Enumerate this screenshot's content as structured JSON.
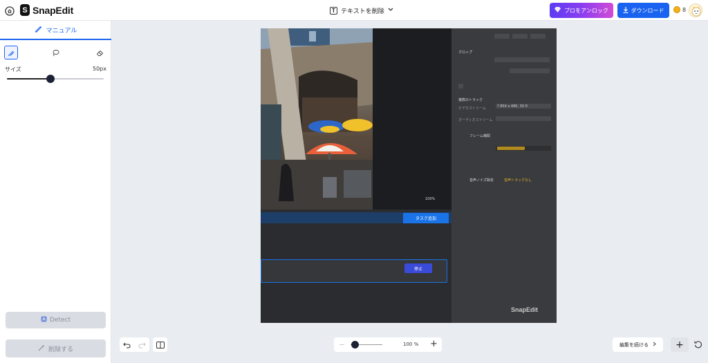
{
  "header": {
    "logo_mark": "S",
    "logo_text": "SnapEdit",
    "tool_badge": "T",
    "tool_label": "テキストを削除",
    "pro_button": "プロをアンロック",
    "download_button": "ダウンロード",
    "credits": "8"
  },
  "sidebar": {
    "tab_label": "マニュアル",
    "size_label": "サイズ",
    "size_value": "50px",
    "size_fraction": 0.45,
    "detect_button": "Detect",
    "remove_button": "削除する"
  },
  "canvas": {
    "task_button": "タスク追加",
    "stop_button": "停止",
    "watermark": "SnapEdit",
    "zoom_readout": "100%",
    "panel": {
      "crop_title": "クロップ",
      "tracks_title": "複数のトラック",
      "video_stream_label": "ビデオストリーム",
      "video_stream_value": "? 854 x 480, 30 fl",
      "audio_stream_label": "オーディオストリーム",
      "frame_label": "フレーム補間",
      "noise_label": "音声ノイズ除去",
      "noise_value": "音声トラックなし"
    }
  },
  "toolbar": {
    "zoom_percent": "100 %",
    "zoom_minus": "−",
    "zoom_plus": "+",
    "continue_button": "編集を続ける",
    "add_button": "+"
  },
  "colors": {
    "accent": "#1a63f0",
    "pro_gradient_start": "#5b3cf2",
    "pro_gradient_end": "#d14bd6"
  }
}
